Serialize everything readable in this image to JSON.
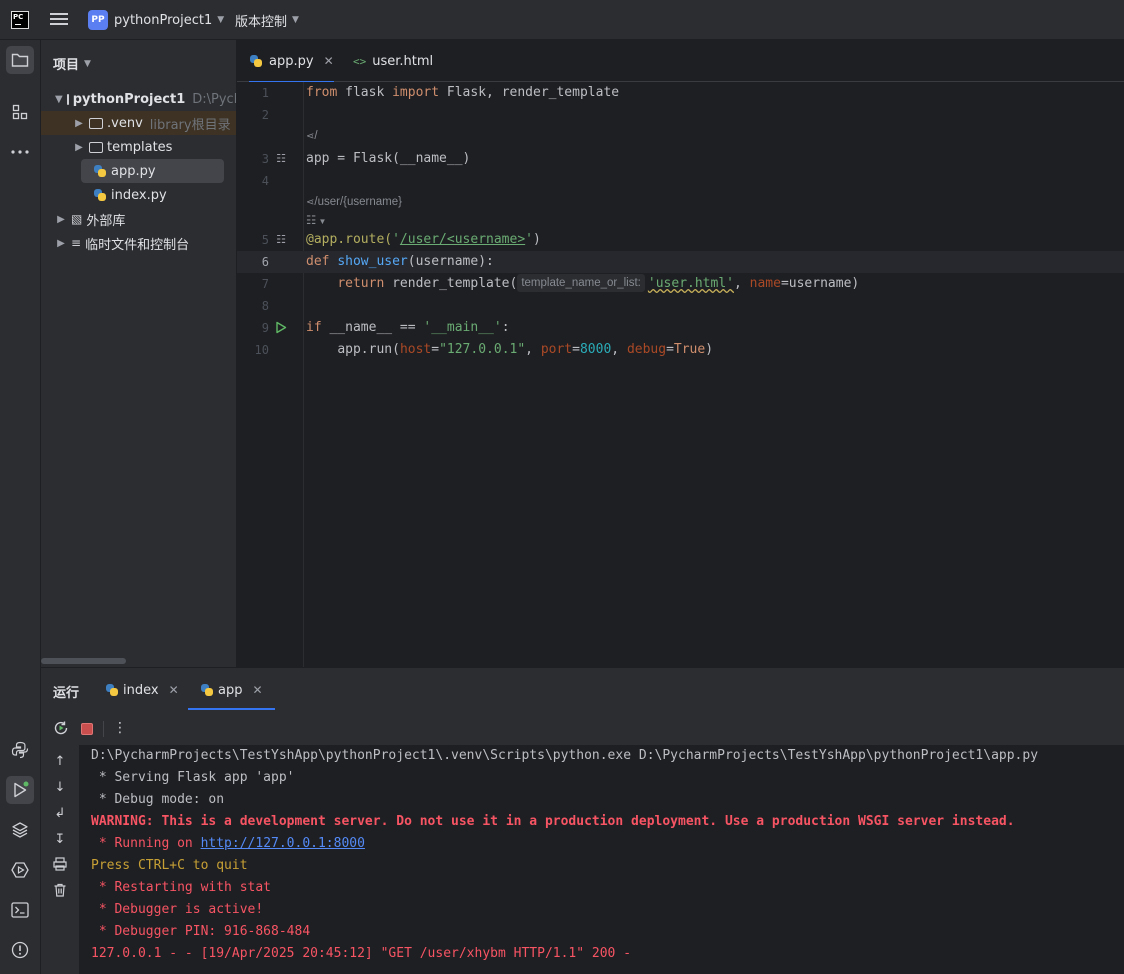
{
  "titlebar": {
    "logo_text": "PC",
    "project_badge": "PP",
    "project_name": "pythonProject1",
    "vcs_label": "版本控制"
  },
  "left_strip": {
    "icons": [
      "folder-icon",
      "structure-icon",
      "more-icon",
      "python-console-icon",
      "run-icon",
      "layers-icon",
      "services-icon",
      "terminal-icon",
      "problems-icon"
    ]
  },
  "project_panel": {
    "title": "项目",
    "tree": [
      {
        "label": "pythonProject1",
        "hint": "D:\\Pych",
        "type": "folder",
        "level": 0,
        "expanded": true
      },
      {
        "label": ".venv",
        "hint": "library根目录",
        "type": "folder",
        "level": 1,
        "expanded": false
      },
      {
        "label": "templates",
        "hint": "",
        "type": "folder",
        "level": 1,
        "expanded": false
      },
      {
        "label": "app.py",
        "hint": "",
        "type": "python",
        "level": 1,
        "selected": true
      },
      {
        "label": "index.py",
        "hint": "",
        "type": "python",
        "level": 1
      },
      {
        "label": "外部库",
        "hint": "",
        "type": "library",
        "level": 0
      },
      {
        "label": "临时文件和控制台",
        "hint": "",
        "type": "scratch",
        "level": 0
      }
    ]
  },
  "editor": {
    "tabs": [
      {
        "label": "app.py",
        "active": true
      },
      {
        "label": "user.html",
        "active": false
      }
    ],
    "route_hint_1": "/",
    "route_hint_2": "/user/{username}",
    "param_hint": "template_name_or_list:",
    "line_numbers": [
      "1",
      "2",
      "3",
      "4",
      "5",
      "6",
      "7",
      "8",
      "9",
      "10"
    ],
    "code": {
      "l1_from": "from",
      "l1_mod": " flask ",
      "l1_import": "import",
      "l1_rest": " Flask, render_template",
      "l3": "app = Flask(__name__)",
      "l5_dec": "@app.route(",
      "l5_q1": "'",
      "l5_url": "/user/<username>",
      "l5_q2": "'",
      "l5_end": ")",
      "l6_def": "def",
      "l6_fn": "show_user",
      "l6_rest": "(username):",
      "l7_return": "return",
      "l7_call": " render_template(",
      "l7_str": "'user.html'",
      "l7_comma": ", ",
      "l7_name": "name",
      "l7_rest": "=username)",
      "l9_if": "if",
      "l9_mid": " __name__ == ",
      "l9_str": "'__main__'",
      "l9_end": ":",
      "l10_call": "app.run(",
      "l10_host": "host",
      "l10_eq1": "=",
      "l10_hostval": "\"127.0.0.1\"",
      "l10_c1": ", ",
      "l10_port": "port",
      "l10_eq2": "=",
      "l10_portval": "8000",
      "l10_c2": ", ",
      "l10_debug": "debug",
      "l10_eq3": "=",
      "l10_true": "True",
      "l10_end": ")"
    }
  },
  "run_panel": {
    "title": "运行",
    "tabs": [
      {
        "label": "index",
        "active": false
      },
      {
        "label": "app",
        "active": true
      }
    ],
    "console": {
      "cmd": "D:\\PycharmProjects\\TestYshApp\\pythonProject1\\.venv\\Scripts\\python.exe D:\\PycharmProjects\\TestYshApp\\pythonProject1\\app.py",
      "serving": " * Serving Flask app 'app'",
      "debug_mode": " * Debug mode: on",
      "warning": "WARNING: This is a development server. Do not use it in a production deployment. Use a production WSGI server instead.",
      "running_prefix": " * Running on ",
      "running_url": "http://127.0.0.1:8000",
      "quit": "Press CTRL+C to quit",
      "restarting": " * Restarting with stat",
      "debugger_active": " * Debugger is active!",
      "debugger_pin": " * Debugger PIN: 916-868-484",
      "request": "127.0.0.1 - - [19/Apr/2025 20:45:12] \"GET /user/xhybm HTTP/1.1\" 200 -"
    }
  }
}
